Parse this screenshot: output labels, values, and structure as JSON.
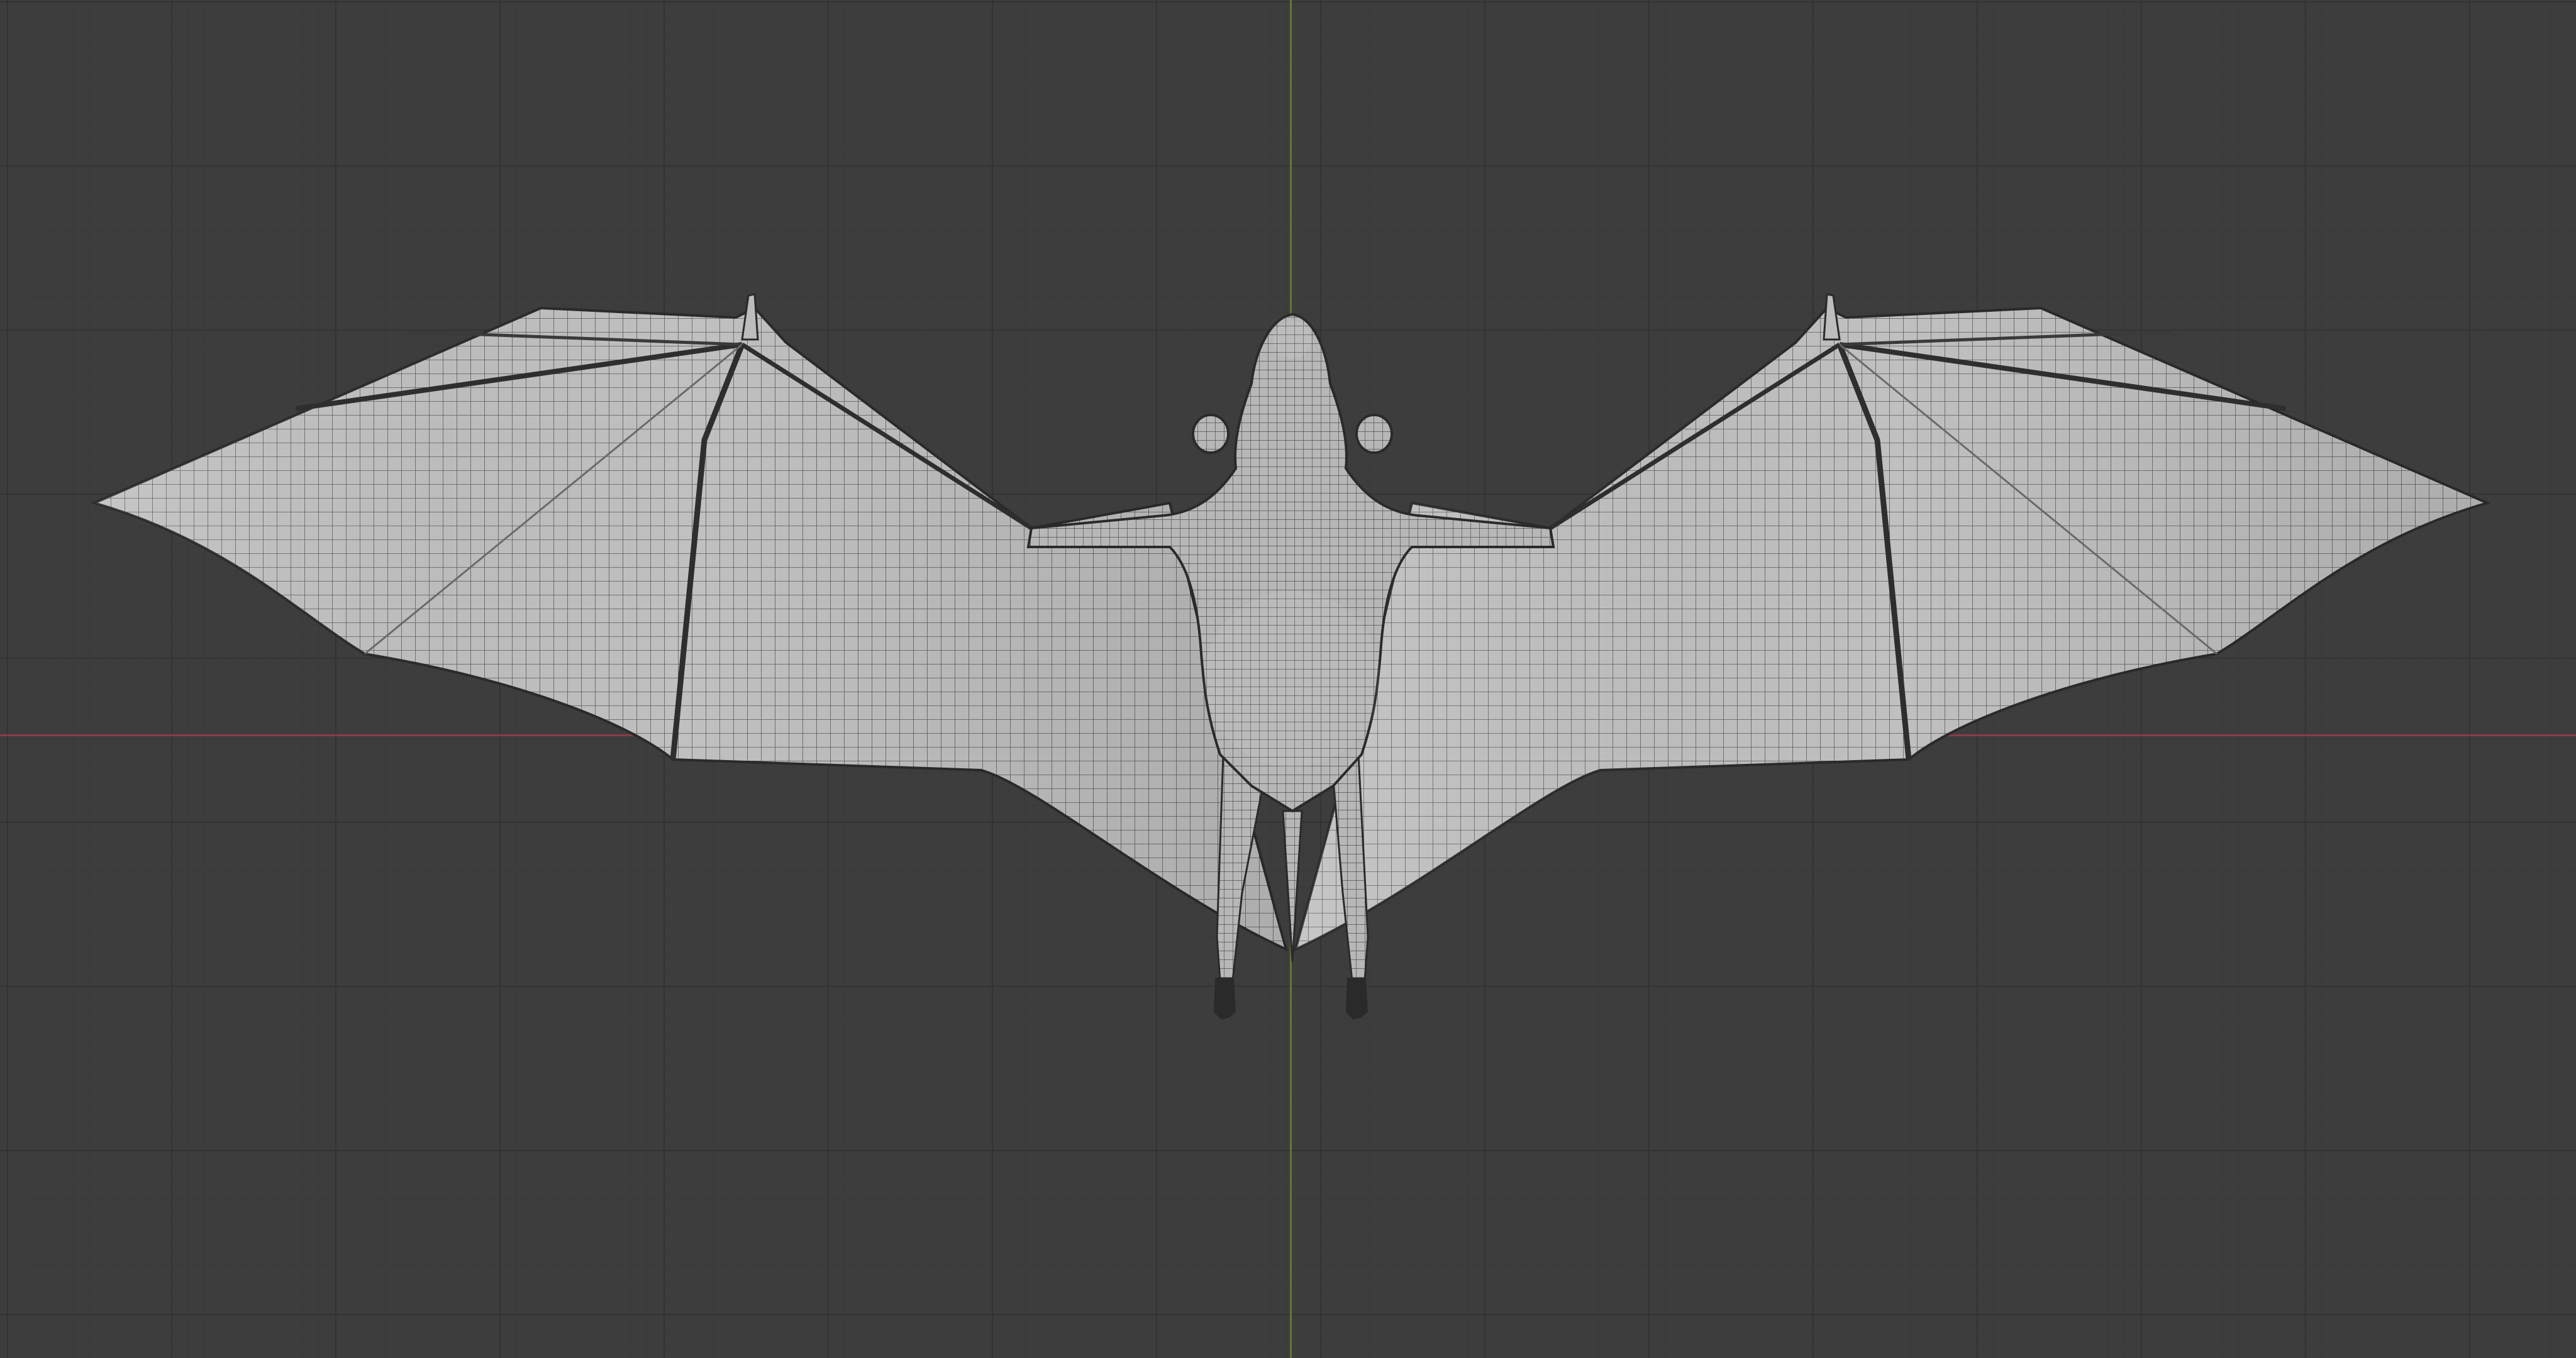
{
  "viewport": {
    "view": "3d-viewport",
    "background_color": "#3d3d3d",
    "grid_color": "#333333",
    "x_axis_color": "#8a3b46",
    "y_axis_color": "#5f7a2c"
  },
  "model": {
    "subject": "bat",
    "display": "wireframe-over-solid",
    "surface_color": "#bdbdbd",
    "wire_color": "#555555"
  }
}
